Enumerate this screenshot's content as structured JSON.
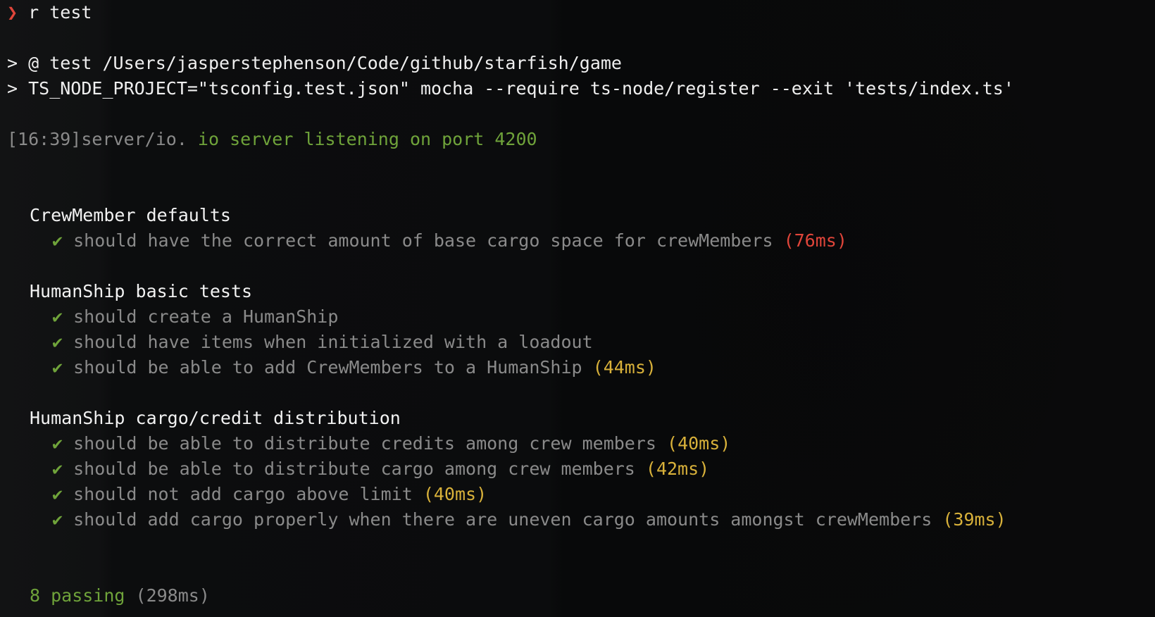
{
  "prompt": {
    "symbol": "❯",
    "command": "r test"
  },
  "npm_header": [
    "> @ test /Users/jasperstephenson/Code/github/starfish/game",
    "> TS_NODE_PROJECT=\"tsconfig.test.json\" mocha --require ts-node/register --exit 'tests/index.ts'"
  ],
  "log": {
    "prefix": "[16:39]server/io.",
    "message": " io server listening on port 4200"
  },
  "check_symbol": "✔",
  "suites": [
    {
      "title": "CrewMember defaults",
      "tests": [
        {
          "name": "should have the correct amount of base cargo space for crewMembers",
          "duration": "(76ms)"
        }
      ]
    },
    {
      "title": "HumanShip basic tests",
      "tests": [
        {
          "name": "should create a HumanShip",
          "duration": ""
        },
        {
          "name": "should have items when initialized with a loadout",
          "duration": ""
        },
        {
          "name": "should be able to add CrewMembers to a HumanShip",
          "duration": "(44ms)"
        }
      ]
    },
    {
      "title": "HumanShip cargo/credit distribution",
      "tests": [
        {
          "name": "should be able to distribute credits among crew members",
          "duration": "(40ms)"
        },
        {
          "name": "should be able to distribute cargo among crew members",
          "duration": "(42ms)"
        },
        {
          "name": "should not add cargo above limit",
          "duration": "(40ms)"
        },
        {
          "name": "should add cargo properly when there are uneven cargo amounts amongst crewMembers",
          "duration": "(39ms)"
        }
      ]
    }
  ],
  "summary": {
    "passing": "8 passing",
    "duration": " (298ms)"
  },
  "colors": {
    "prompt": "#e0453a",
    "pass": "#6fa33a",
    "slow": "#e0453a",
    "medium": "#d8b13a",
    "dim": "#8a8a8a",
    "background": "#0b0c0d"
  }
}
